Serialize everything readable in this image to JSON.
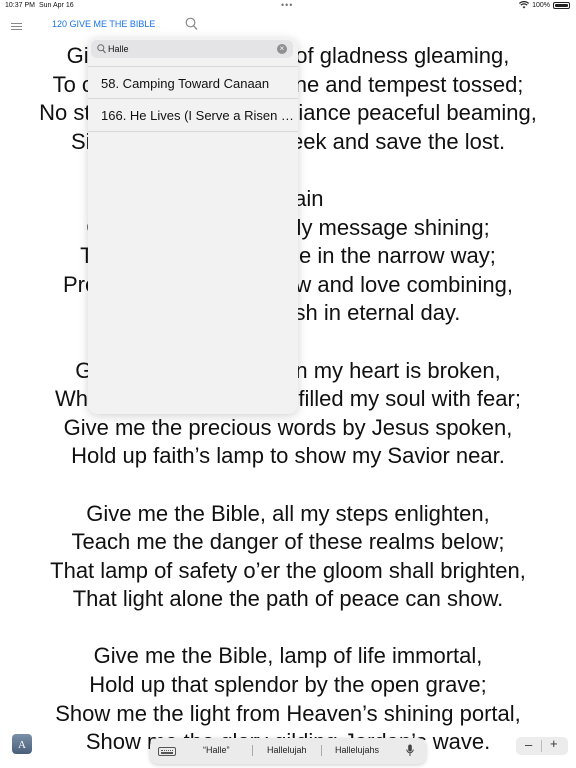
{
  "status": {
    "time": "10:37 PM",
    "date": "Sun Apr 16",
    "dots": "•••",
    "battery": "100%"
  },
  "nav": {
    "title": "120 GIVE ME THE BIBLE"
  },
  "lyrics": [
    "Give me the Bible, star of gladness gleaming,",
    "To cheer the wanderer lone and tempest tossed;",
    "No storm can hide that radiance peaceful beaming,",
    "Since Jesus came to seek and save the lost.",
    "",
    "Refrain",
    "Give me the Bible, holy message shining;",
    "Thy light shall guide me in the narrow way;",
    "Precept and promise, law and love combining,",
    "Till night shall vanish in eternal day.",
    "",
    "Give me the Bible when my heart is broken,",
    "When sin and grief have filled my soul with fear;",
    "Give me the precious words by Jesus spoken,",
    "Hold up faith’s lamp to show my Savior near.",
    "",
    "Give me the Bible, all my steps enlighten,",
    "Teach me the danger of these realms below;",
    "That lamp of safety o’er the gloom shall brighten,",
    "That light alone the path of peace can show.",
    "",
    "Give me the Bible, lamp of life immortal,",
    "Hold up that splendor by the open grave;",
    "Show me the light from Heaven’s shining portal,",
    "Show me the glory gilding Jordan’s wave."
  ],
  "search": {
    "value": "Halle",
    "clear": "×"
  },
  "results": [
    "58. Camping Toward Canaan",
    "166. He Lives (I Serve a Risen Savior)"
  ],
  "keyboard": {
    "suggestions": [
      "“Halle”",
      "Hallelujah",
      "Hallelujahs"
    ]
  },
  "app_icon": {
    "letter": "A"
  },
  "zoom": {
    "minus": "–",
    "plus": "+"
  }
}
